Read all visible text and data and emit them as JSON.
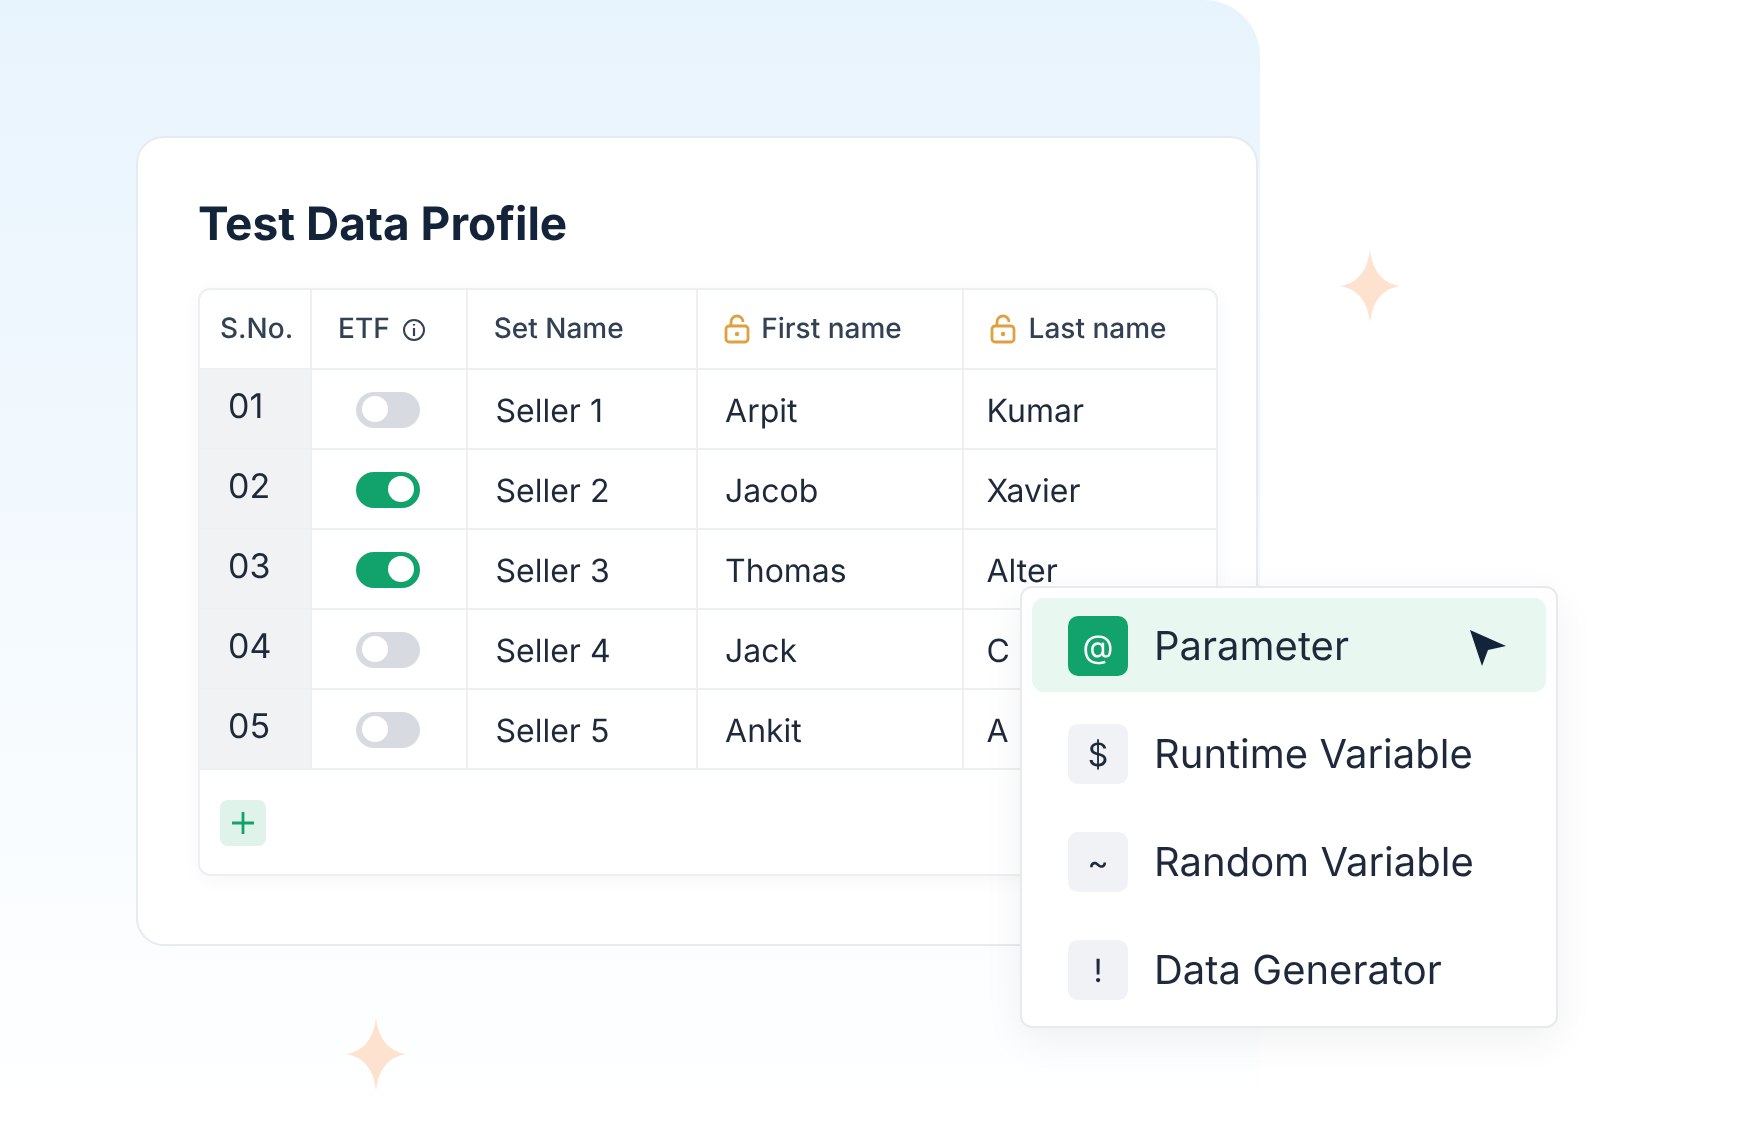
{
  "card": {
    "title": "Test Data Profile"
  },
  "table": {
    "columns": [
      {
        "label": "S.No.",
        "kind": "plain"
      },
      {
        "label": "ETF",
        "kind": "info"
      },
      {
        "label": "Set Name",
        "kind": "plain"
      },
      {
        "label": "First name",
        "kind": "locked"
      },
      {
        "label": "Last name",
        "kind": "locked"
      }
    ],
    "rows": [
      {
        "sno": "01",
        "etf_on": false,
        "set_name": "Seller 1",
        "first_name": "Arpit",
        "last_name": "Kumar"
      },
      {
        "sno": "02",
        "etf_on": true,
        "set_name": "Seller 2",
        "first_name": "Jacob",
        "last_name": "Xavier"
      },
      {
        "sno": "03",
        "etf_on": true,
        "set_name": "Seller 3",
        "first_name": "Thomas",
        "last_name": "Alter"
      },
      {
        "sno": "04",
        "etf_on": false,
        "set_name": "Seller 4",
        "first_name": "Jack",
        "last_name": "C"
      },
      {
        "sno": "05",
        "etf_on": false,
        "set_name": "Seller 5",
        "first_name": "Ankit",
        "last_name": "A"
      }
    ]
  },
  "menu": {
    "items": [
      {
        "symbol": "@",
        "label": "Parameter",
        "selected": true
      },
      {
        "symbol": "$",
        "label": "Runtime Variable",
        "selected": false
      },
      {
        "symbol": "~",
        "label": "Random Variable",
        "selected": false
      },
      {
        "symbol": "!",
        "label": "Data Generator",
        "selected": false
      }
    ]
  }
}
